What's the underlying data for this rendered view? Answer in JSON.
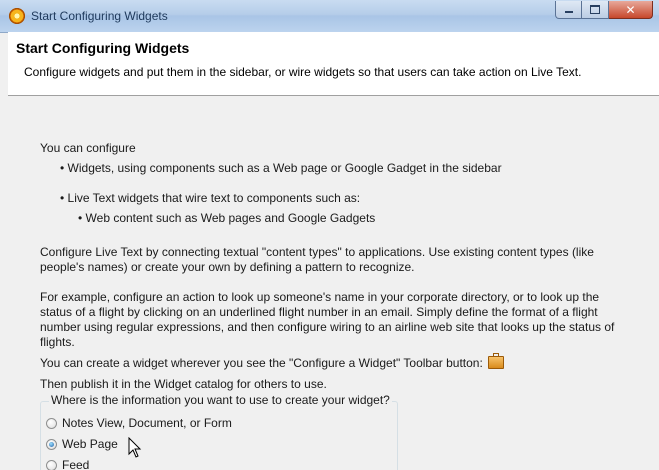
{
  "window": {
    "title": "Start Configuring Widgets",
    "icon": "app-icon",
    "controls": [
      "minimize",
      "maximize",
      "close"
    ]
  },
  "banner": {
    "title": "Start Configuring Widgets",
    "description": "Configure widgets and put them in the sidebar, or wire widgets so that users can take action on Live Text."
  },
  "content": {
    "intro": "You can configure",
    "bullet1": "• Widgets, using components such as a Web page or Google Gadget in the sidebar",
    "bullet2": "• Live Text widgets that wire text to components such as:",
    "bullet2_sub": "• Web content such as Web pages and Google Gadgets",
    "para1": "Configure Live Text by connecting textual \"content types\" to applications. Use existing content types (like people's names) or create your own by defining a pattern to recognize.",
    "para2": "For example, configure an action to look up someone's name in your corporate directory, or to look up the status of a flight by clicking on an underlined flight number in an email.  Simply define the format of a flight number using regular expressions, and then configure wiring to an airline web site that looks up the status of flights.",
    "toolbar_line": "You can create a widget wherever you see the \"Configure a Widget\" Toolbar button:",
    "toolbar_icon": "toolbox-icon",
    "publish_line": "Then publish it in the Widget catalog for others to use."
  },
  "source_group": {
    "legend": "Where is the information you want to use to create your widget?",
    "options": [
      {
        "label": "Notes View, Document, or Form",
        "checked": false
      },
      {
        "label": "Web Page",
        "checked": true
      },
      {
        "label": "Feed",
        "checked": false
      }
    ]
  }
}
